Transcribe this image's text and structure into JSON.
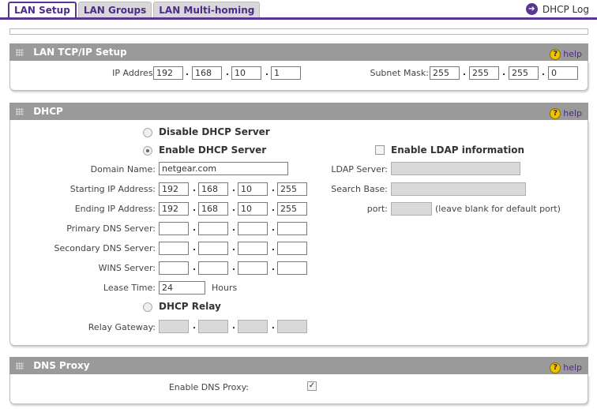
{
  "tabs": [
    {
      "label": "LAN Setup",
      "active": true
    },
    {
      "label": "LAN Groups",
      "active": false
    },
    {
      "label": "LAN Multi-homing",
      "active": false
    }
  ],
  "dhcp_log": "DHCP Log",
  "help_label": "help",
  "lan_tcpip": {
    "title": "LAN TCP/IP Setup",
    "ip_label": "IP Address:",
    "ip": [
      "192",
      "168",
      "10",
      "1"
    ],
    "mask_label": "Subnet Mask:",
    "mask": [
      "255",
      "255",
      "255",
      "0"
    ]
  },
  "dhcp": {
    "title": "DHCP",
    "disable_label": "Disable DHCP Server",
    "enable_label": "Enable DHCP Server",
    "enable_ldap_label": "Enable LDAP information",
    "domain_label": "Domain Name:",
    "domain": "netgear.com",
    "start_label": "Starting IP Address:",
    "start": [
      "192",
      "168",
      "10",
      "255"
    ],
    "end_label": "Ending IP Address:",
    "end": [
      "192",
      "168",
      "10",
      "255"
    ],
    "pdns_label": "Primary DNS Server:",
    "sdns_label": "Secondary DNS Server:",
    "wins_label": "WINS Server:",
    "lease_label": "Lease Time:",
    "lease": "24",
    "hours_label": "Hours",
    "relay_label": "DHCP Relay",
    "relay_gw_label": "Relay Gateway:",
    "ldap_server_label": "LDAP Server:",
    "search_base_label": "Search Base:",
    "port_label": "port:",
    "port_hint": "(leave blank for default port)",
    "dhcp_mode": "enable"
  },
  "dns_proxy": {
    "title": "DNS Proxy",
    "enable_label": "Enable DNS Proxy:",
    "enabled": true
  },
  "dot": ".",
  "colors": {
    "accent": "#5b3690",
    "section_header": "#9a9a9a",
    "help_icon": "#f2c200"
  }
}
